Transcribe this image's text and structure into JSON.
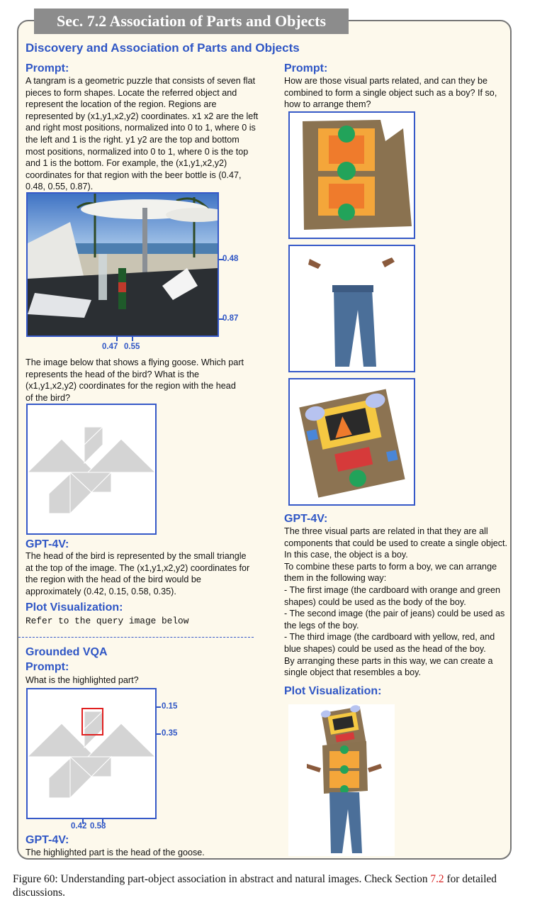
{
  "section_title": "Sec. 7.2 Association of Parts and Objects",
  "heading_main": "Discovery and Association of Parts and Objects",
  "left": {
    "prompt_label": "Prompt:",
    "prompt_text": "A tangram is a geometric puzzle that consists of seven flat pieces to form shapes. Locate the referred object and represent the location of the region. Regions are represented by (x1,y1,x2,y2) coordinates. x1 x2 are the left and right most positions, normalized into 0 to 1, where 0 is the left and 1 is the right. y1 y2 are the top and bottom most positions, normalized into 0 to 1, where 0 is the top and 1 is the bottom. For example, the (x1,y1,x2,y2) coordinates for that region with the beer bottle is (0.47, 0.48, 0.55, 0.87).",
    "photo_labels": {
      "y1": "0.48",
      "y2": "0.87",
      "x1": "0.47",
      "x2": "0.55"
    },
    "query_text": "The image below that shows a flying goose. Which part represents the head of the bird? What is the (x1,y1,x2,y2) coordinates for the region with the head of the bird?",
    "gpt_label": "GPT-4V:",
    "gpt_text": "The head of the bird is represented by the small triangle at the top of the image. The (x1,y1,x2,y2) coordinates for the region with the head of the bird would be approximately (0.42, 0.15, 0.58, 0.35).",
    "plot_label": "Plot Visualization:",
    "plot_text": "Refer to the query image below",
    "grounded_heading": "Grounded VQA",
    "grounded_prompt_label": "Prompt:",
    "grounded_prompt_text": "What is the highlighted part?",
    "grounded_labels": {
      "y1": "0.15",
      "y2": "0.35",
      "x1": "0.42",
      "x2": "0.58"
    },
    "grounded_gpt_label": "GPT-4V:",
    "grounded_gpt_text": "The highlighted part is the head of the goose."
  },
  "right": {
    "prompt_label": "Prompt:",
    "prompt_text": "How are those visual parts related, and can they be combined to form a single object such as a boy? If so, how to arrange them?",
    "gpt_label": "GPT-4V:",
    "gpt_lines": [
      "The three visual parts are related in that they are all components that could be used to create a single object. In this case, the object is a boy.",
      "To combine these parts to form a boy, we can arrange them in the following way:",
      "- The first image (the cardboard with orange and green shapes) could be used as the body of the boy.",
      "- The second image (the pair of jeans) could be used as the legs of the boy.",
      "- The third image (the cardboard with yellow, red, and blue shapes) could be used as the head of the boy.",
      "By arranging these parts in this way, we can create a single object that resembles a boy."
    ],
    "plot_label": "Plot Visualization:"
  },
  "caption": {
    "prefix": "Figure 60: Understanding part-object association in abstract and natural images. Check Section ",
    "ref": "7.2",
    "suffix": " for detailed discussions."
  }
}
